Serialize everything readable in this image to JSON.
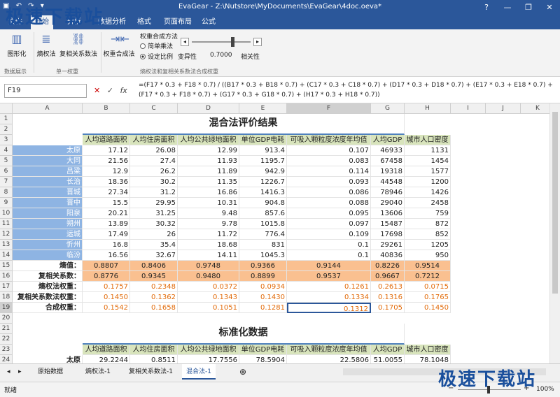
{
  "titlebar": {
    "app": "EvaGear",
    "path": "Z:\\Nutstore\\MyDocuments\\EvaGear\\4doc.oeva*",
    "separator": "-",
    "btn_min": "—",
    "btn_max": "❐",
    "btn_close": "✕",
    "help": "?"
  },
  "menu": [
    {
      "label": "文件",
      "active": false
    },
    {
      "label": "开始",
      "active": true
    },
    {
      "label": "分析",
      "active": false
    },
    {
      "label": "数据分析",
      "active": false
    },
    {
      "label": "格式",
      "active": false
    },
    {
      "label": "页面布局",
      "active": false
    },
    {
      "label": "公式",
      "active": false
    }
  ],
  "ribbon": {
    "btn_figure": "图形化",
    "btn_entropy": "熵权法",
    "btn_corr": "复相关系数法",
    "btn_combine": "权重合成法",
    "combine_method_label": "权重合成方法",
    "opt_simple": "简单乘法",
    "opt_ratio": "设定比例",
    "label_variability": "变异性",
    "slider_value": "0.7000",
    "label_correlation": "相关性",
    "group_display": "数据展示",
    "group_single": "单一权重",
    "group_multi": "熵权法和复相关系数法合成权重"
  },
  "formulabar": {
    "namebox": "F19",
    "cancel": "✕",
    "confirm": "✓",
    "fx": "fx",
    "formula": "=(F17 * 0.3 + F18 * 0.7) / ((B17 * 0.3 + B18 * 0.7) + (C17 * 0.3 + C18 * 0.7) + (D17 * 0.3 + D18 * 0.7) + (E17 * 0.3 + E18 * 0.7) + (F17 * 0.3 + F18 * 0.7) + (G17 * 0.3 + G18 * 0.7) + (H17 * 0.3 + H18 * 0.7))"
  },
  "columns": [
    "A",
    "B",
    "C",
    "D",
    "E",
    "F",
    "G",
    "H",
    "I",
    "J",
    "K"
  ],
  "rows": [
    "1",
    "2",
    "3",
    "4",
    "5",
    "6",
    "7",
    "8",
    "9",
    "10",
    "11",
    "12",
    "13",
    "14",
    "15",
    "16",
    "17",
    "18",
    "19",
    "20",
    "21",
    "22",
    "23",
    "24"
  ],
  "sheet": {
    "title1": "混合法评价结果",
    "title2": "标准化数据",
    "headers": [
      "人均道路面积",
      "人均住房面积",
      "人均公共绿地面积",
      "单位GDP电耗",
      "可吸入颗粒度浓度年均值",
      "人均GDP",
      "城市人口密度"
    ],
    "cities": [
      {
        "name": "太原",
        "v": [
          "17.12",
          "26.08",
          "12.99",
          "913.4",
          "0.107",
          "46933",
          "1131"
        ]
      },
      {
        "name": "大同",
        "v": [
          "21.56",
          "27.4",
          "11.93",
          "1195.7",
          "0.083",
          "67458",
          "1454"
        ]
      },
      {
        "name": "吕梁",
        "v": [
          "12.9",
          "26.2",
          "11.89",
          "942.9",
          "0.114",
          "19318",
          "1577"
        ]
      },
      {
        "name": "长治",
        "v": [
          "18.36",
          "30.2",
          "11.35",
          "1226.7",
          "0.093",
          "44548",
          "1200"
        ]
      },
      {
        "name": "晋城",
        "v": [
          "27.34",
          "31.2",
          "16.86",
          "1416.3",
          "0.086",
          "78946",
          "1426"
        ]
      },
      {
        "name": "晋中",
        "v": [
          "15.5",
          "29.95",
          "10.31",
          "904.8",
          "0.088",
          "29040",
          "2458"
        ]
      },
      {
        "name": "阳泉",
        "v": [
          "20.21",
          "31.25",
          "9.48",
          "857.6",
          "0.095",
          "13606",
          "759"
        ]
      },
      {
        "name": "朔州",
        "v": [
          "13.89",
          "30.32",
          "9.78",
          "1015.8",
          "0.097",
          "15487",
          "872"
        ]
      },
      {
        "name": "运城",
        "v": [
          "17.49",
          "26",
          "11.72",
          "776.4",
          "0.109",
          "17698",
          "852"
        ]
      },
      {
        "name": "忻州",
        "v": [
          "16.8",
          "35.4",
          "18.68",
          "831",
          "0.1",
          "29261",
          "1205"
        ]
      },
      {
        "name": "临汾",
        "v": [
          "16.56",
          "32.67",
          "14.11",
          "1045.3",
          "0.1",
          "40836",
          "950"
        ]
      }
    ],
    "summary": [
      {
        "label": "熵值：",
        "v": [
          "0.8807",
          "0.8406",
          "0.9748",
          "0.9366",
          "0.9144",
          "0.8226",
          "0.9514"
        ]
      },
      {
        "label": "复相关系数：",
        "v": [
          "0.8776",
          "0.9345",
          "0.9480",
          "0.8899",
          "0.9537",
          "0.9667",
          "0.7212"
        ]
      },
      {
        "label": "熵权法权重：",
        "v": [
          "0.1757",
          "0.2348",
          "0.0372",
          "0.0934",
          "0.1261",
          "0.2613",
          "0.0715"
        ]
      },
      {
        "label": "复相关系数法权重：",
        "v": [
          "0.1450",
          "0.1362",
          "0.1343",
          "0.1430",
          "0.1334",
          "0.1316",
          "0.1765"
        ]
      },
      {
        "label": "合成权重：",
        "v": [
          "0.1542",
          "0.1658",
          "0.1051",
          "0.1281",
          "0.1312",
          "0.1705",
          "0.1450"
        ]
      }
    ],
    "std_header": [
      "人均道路面积",
      "人均住房面积",
      "人均公共绿地面积",
      "单位GDP电耗",
      "可吸入颗粒度浓度年均值",
      "人均GDP",
      "城市人口密度"
    ],
    "std_row": {
      "name": "太原",
      "v": [
        "29.2244",
        "0.8511",
        "17.7556",
        "78.5904",
        "22.5806",
        "51.0055",
        "78.1048"
      ]
    }
  },
  "tabs": [
    {
      "label": "原始数据",
      "active": false
    },
    {
      "label": "熵权法-1",
      "active": false
    },
    {
      "label": "复相关系数法-1",
      "active": false
    },
    {
      "label": "混合法-1",
      "active": true
    }
  ],
  "tab_add": "⊕",
  "status": {
    "left": "就绪",
    "zoom": "100%",
    "zoom_minus": "−",
    "zoom_plus": "+"
  },
  "watermark": "极速下载站",
  "colors": {
    "blue_header": "#2b579a",
    "city": "#8eb4e3",
    "header_fill": "#d8e4bc",
    "summary_fill": "#fac090",
    "weight_text": "#e26b0a",
    "title_line": "#4f81bd"
  }
}
